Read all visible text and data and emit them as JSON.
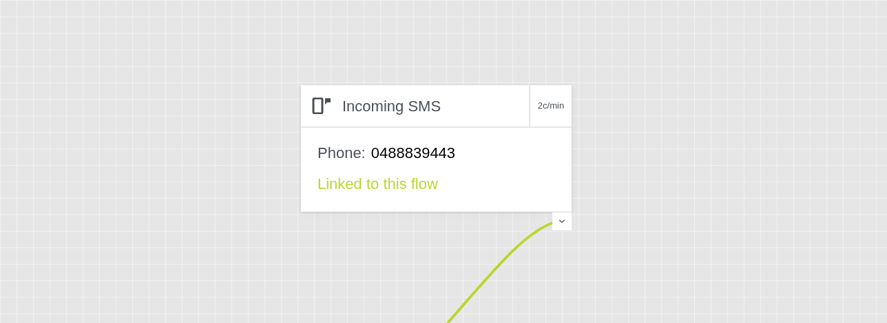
{
  "node": {
    "title": "Incoming SMS",
    "rate": "2c/min",
    "fields": [
      {
        "label": "Phone:",
        "value": "0488839443"
      }
    ],
    "link_status": "Linked to this flow"
  }
}
